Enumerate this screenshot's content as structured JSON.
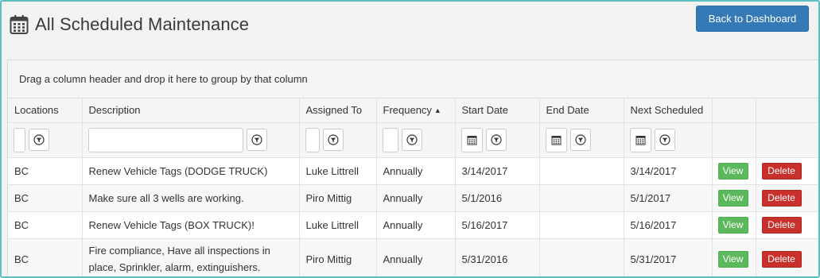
{
  "header": {
    "title": "All Scheduled Maintenance",
    "title_icon": "calendar-icon",
    "back_button": "Back to Dashboard"
  },
  "grid": {
    "group_hint": "Drag a column header and drop it here to group by that column",
    "columns": [
      {
        "label": "Locations"
      },
      {
        "label": "Description"
      },
      {
        "label": "Assigned To"
      },
      {
        "label": "Frequency",
        "sort": "ascending"
      },
      {
        "label": "Start Date"
      },
      {
        "label": "End Date"
      },
      {
        "label": "Next Scheduled"
      }
    ],
    "filters": {
      "locations": "",
      "description": "",
      "assigned_to": "",
      "frequency": "",
      "start_date": "",
      "end_date": "",
      "next_scheduled": ""
    },
    "rows": [
      {
        "location": "BC",
        "description": "Renew Vehicle Tags (DODGE TRUCK)",
        "assigned_to": "Luke Littrell",
        "frequency": "Annually",
        "start_date": "3/14/2017",
        "end_date": "",
        "next_scheduled": "3/14/2017",
        "view": "View",
        "delete": "Delete"
      },
      {
        "location": "BC",
        "description": "Make sure all 3 wells are working.",
        "assigned_to": "Piro Mittig",
        "frequency": "Annually",
        "start_date": "5/1/2016",
        "end_date": "",
        "next_scheduled": "5/1/2017",
        "view": "View",
        "delete": "Delete"
      },
      {
        "location": "BC",
        "description": "Renew Vehicle Tags (BOX TRUCK)!",
        "assigned_to": "Luke Littrell",
        "frequency": "Annually",
        "start_date": "5/16/2017",
        "end_date": "",
        "next_scheduled": "5/16/2017",
        "view": "View",
        "delete": "Delete"
      },
      {
        "location": "BC",
        "description": "Fire compliance, Have all inspections in place, Sprinkler, alarm, extinguishers.",
        "assigned_to": "Piro Mittig",
        "frequency": "Annually",
        "start_date": "5/31/2016",
        "end_date": "",
        "next_scheduled": "5/31/2017",
        "view": "View",
        "delete": "Delete"
      }
    ]
  },
  "colors": {
    "primary": "#337ab7",
    "success": "#5cb85c",
    "danger": "#c9302c",
    "frame_border": "#5cc0c0"
  }
}
